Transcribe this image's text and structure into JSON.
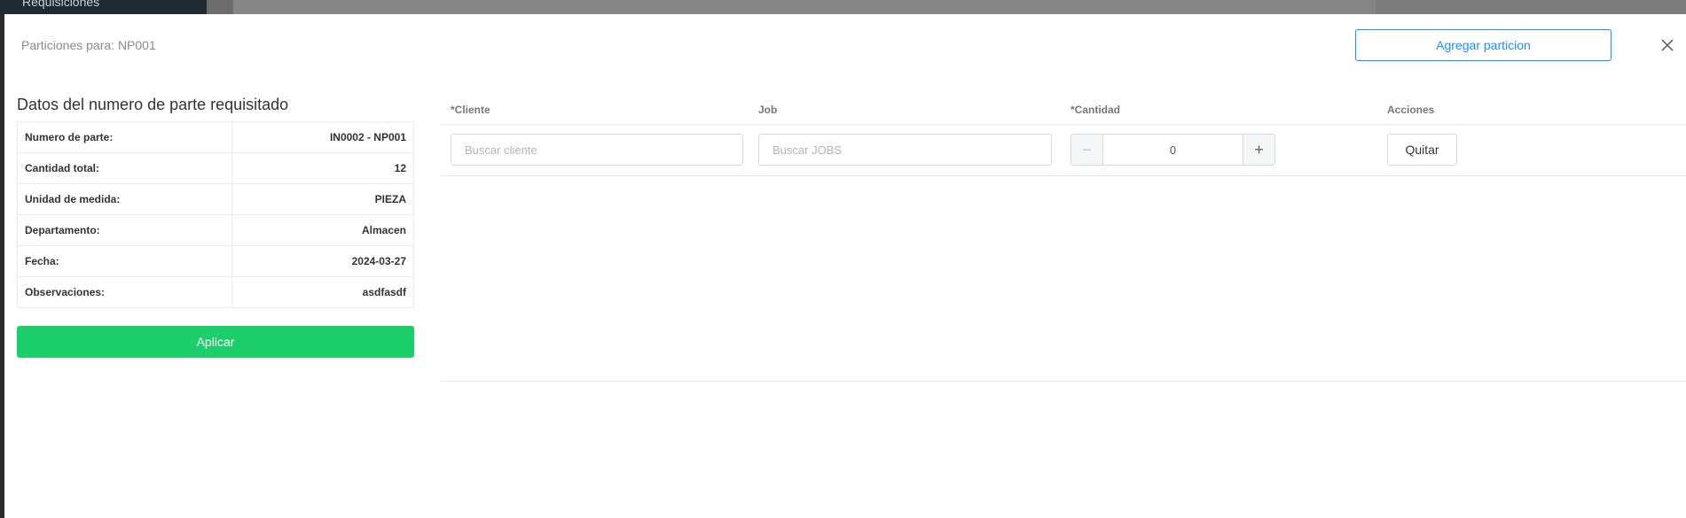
{
  "background": {
    "sidebar_label": "Requisiciones"
  },
  "modal": {
    "title": "Particiones para: NP001",
    "add_button_label": "Agregar particion",
    "close_icon": "close-icon"
  },
  "details": {
    "title": "Datos del numero de parte requisitado",
    "rows": [
      {
        "label": "Numero de parte:",
        "value": "IN0002 - NP001"
      },
      {
        "label": "Cantidad total:",
        "value": "12"
      },
      {
        "label": "Unidad de medida:",
        "value": "PIEZA"
      },
      {
        "label": "Departamento:",
        "value": "Almacen"
      },
      {
        "label": "Fecha:",
        "value": "2024-03-27"
      },
      {
        "label": "Observaciones:",
        "value": "asdfasdf"
      }
    ],
    "apply_button_label": "Aplicar"
  },
  "grid": {
    "headers": {
      "cliente": "*Cliente",
      "job": "Job",
      "cantidad": "*Cantidad",
      "acciones": "Acciones"
    },
    "row": {
      "cliente_placeholder": "Buscar cliente",
      "job_placeholder": "Buscar JOBS",
      "cantidad_value": "0",
      "minus_symbol": "−",
      "plus_symbol": "+",
      "remove_label": "Quitar"
    }
  },
  "colors": {
    "primary": "#1890ff",
    "success": "#1ccf6b"
  }
}
